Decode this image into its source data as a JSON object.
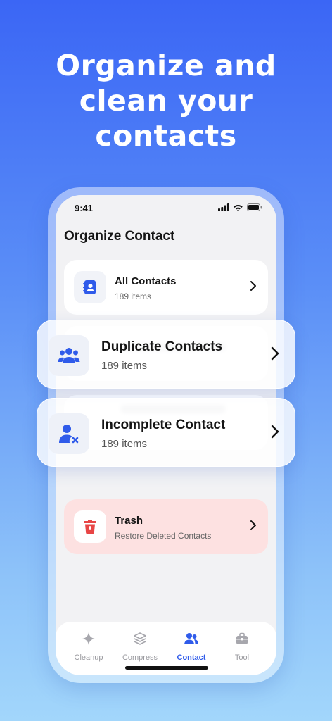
{
  "headline": {
    "line1": "Organize and",
    "line2": "clean your",
    "line3": "contacts"
  },
  "status_bar": {
    "time": "9:41"
  },
  "screen": {
    "title": "Organize Contact",
    "cards": {
      "all_contacts": {
        "title": "All Contacts",
        "subtitle": "189 items",
        "icon": "contact-book-icon"
      },
      "trash": {
        "title": "Trash",
        "subtitle": "Restore Deleted Contacts",
        "icon": "trash-icon"
      }
    }
  },
  "floating_cards": {
    "duplicate": {
      "title": "Duplicate Contacts",
      "subtitle": "189 items",
      "icon": "group-users-icon"
    },
    "incomplete": {
      "title": "Incomplete Contact",
      "subtitle": "189 items",
      "icon": "user-remove-icon"
    }
  },
  "tab_bar": {
    "tabs": [
      {
        "label": "Cleanup",
        "icon": "sparkle-icon",
        "active": false
      },
      {
        "label": "Compress",
        "icon": "layers-icon",
        "active": false
      },
      {
        "label": "Contact",
        "icon": "contacts-icon",
        "active": true
      },
      {
        "label": "Tool",
        "icon": "toolbox-icon",
        "active": false
      }
    ]
  },
  "colors": {
    "accent": "#2f5bea",
    "trash_red": "#e84545",
    "trash_bg": "#fde1e1",
    "background_top": "#3b66f5",
    "background_bottom": "#a2d6fb"
  }
}
